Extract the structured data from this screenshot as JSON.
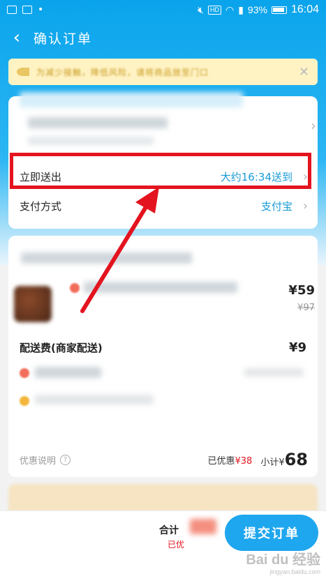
{
  "status_bar": {
    "battery": "93%",
    "time": "16:04",
    "hd": "HD"
  },
  "header": {
    "title": "确认订单"
  },
  "notice": {
    "text": "为减少接触，降低风险，请将商品放至门口"
  },
  "delivery": {
    "label": "立即送出",
    "value": "大约16:34送到"
  },
  "payment": {
    "label": "支付方式",
    "value": "支付宝"
  },
  "item": {
    "price": "¥59",
    "original_price": "¥97"
  },
  "fee": {
    "label": "配送费(商家配送)",
    "value": "¥9"
  },
  "summary": {
    "discount_note": "优惠说明",
    "saved_label": "已优惠",
    "saved_value": "¥38",
    "subtotal_label": "小计¥",
    "subtotal_value": "68"
  },
  "footer": {
    "total_label": "合计",
    "saved_short": "已优",
    "submit": "提交订单"
  },
  "watermark": {
    "text": "Bai du 经验",
    "sub": "jingyan.baidu.com"
  },
  "colors": {
    "accent_blue": "#1ea6ee",
    "highlight_red": "#e3141f",
    "link_blue": "#1a9bd7"
  }
}
